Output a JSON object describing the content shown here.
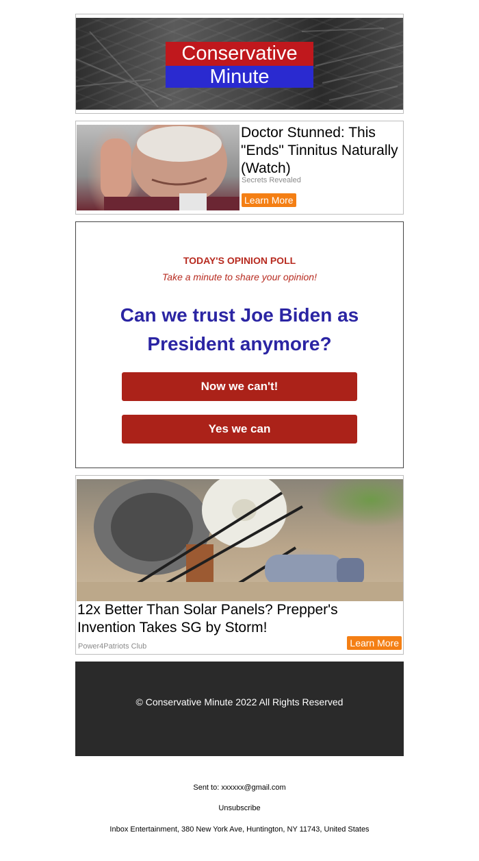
{
  "header": {
    "logo_line1": "Conservative",
    "logo_line2": "Minute"
  },
  "ad1": {
    "title": "Doctor Stunned: This \"Ends\" Tinnitus Naturally (Watch)",
    "source": "Secrets Revealed",
    "button": "Learn More"
  },
  "poll": {
    "label": "TODAY'S OPINION POLL",
    "subtitle": "Take a minute to share your opinion!",
    "question": "Can we trust Joe Biden as President anymore?",
    "option1": "Now we can't!",
    "option2": "Yes we can"
  },
  "ad2": {
    "title": "12x Better Than Solar Panels? Prepper's Invention Takes SG by Storm!",
    "source": "Power4Patriots Club",
    "button": "Learn More"
  },
  "footer": {
    "copyright": "© Conservative Minute 2022 All Rights Reserved"
  },
  "meta": {
    "sent_to": "Sent to: xxxxxx@gmail.com",
    "unsubscribe": "Unsubscribe",
    "address": "Inbox Entertainment, 380 New York Ave, Huntington, NY 11743, United States"
  },
  "colors": {
    "logo_red": "#c0181d",
    "logo_blue": "#2a2ad0",
    "poll_red": "#b72a1f",
    "poll_question_blue": "#2b25a3",
    "poll_button": "#ab2219",
    "learn_more_orange": "#f47f14",
    "footer_bg": "#2a2a2a"
  }
}
